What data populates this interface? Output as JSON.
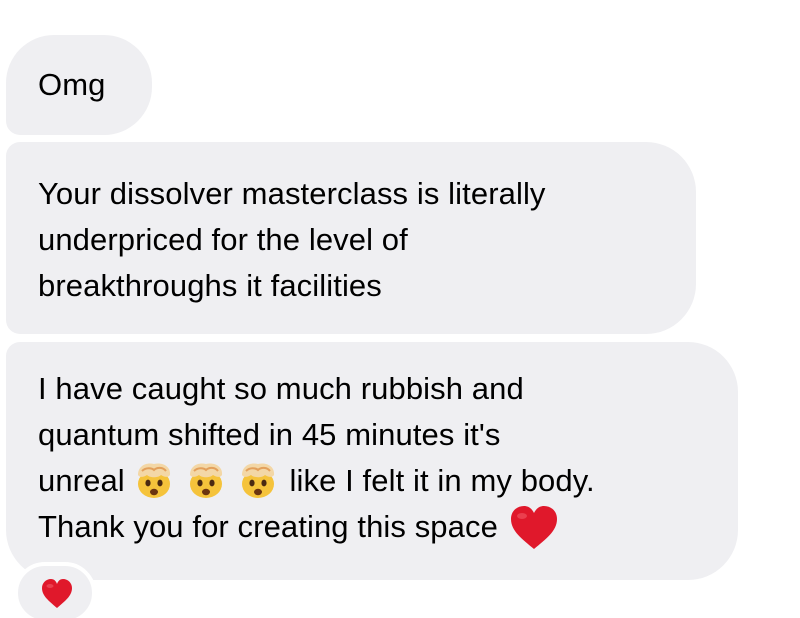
{
  "messages": [
    {
      "lines": [
        "Omg"
      ]
    },
    {
      "lines": [
        "Your dissolver masterclass is literally",
        "underpriced for the level of",
        "breakthroughs it facilities"
      ]
    },
    {
      "line1": "I have caught so much rubbish and",
      "line2": "quantum shifted in 45 minutes it's",
      "line3_before": "unreal",
      "line3_after": "like I felt it in my body.",
      "line4": "Thank you for creating this space",
      "emojis": [
        "exploding-head-emoji",
        "exploding-head-emoji",
        "exploding-head-emoji"
      ],
      "trailing_emoji": "red-heart-emoji"
    }
  ],
  "reaction": {
    "emoji": "red-heart-emoji"
  },
  "colors": {
    "bubble_background": "#efeff2",
    "text": "#000000",
    "heart": "#e0182b",
    "emoji_face": "#f5c33b"
  }
}
